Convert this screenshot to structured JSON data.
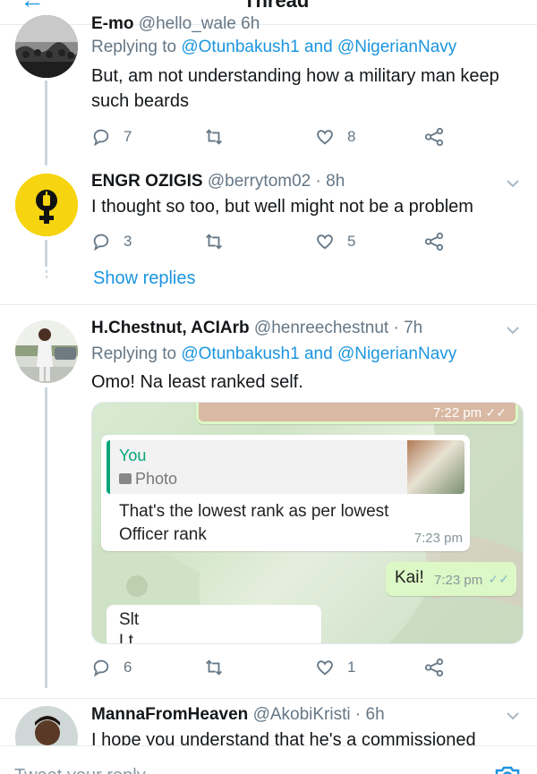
{
  "header": {
    "title": "Thread"
  },
  "tweets": [
    {
      "name": "E-mo",
      "handle": "@hello_wale",
      "time": "6h",
      "replying_prefix": "Replying to ",
      "reply_user1": "@Otunbakush1",
      "reply_and": " and ",
      "reply_user2": "@NigerianNavy",
      "text": "But, am not understanding how a military man keep such beards",
      "replies": "7",
      "retweets": "",
      "likes": "8"
    },
    {
      "name": "ENGR OZIGIS",
      "handle": "@berrytom02",
      "dot": "·",
      "time": "8h",
      "text": "I thought so too, but well might not be a problem",
      "replies": "3",
      "retweets": "",
      "likes": "5"
    },
    {
      "name": "H.Chestnut, ACIArb",
      "handle": "@henreechestnut",
      "dot": "·",
      "time": "7h",
      "replying_prefix": "Replying to ",
      "reply_user1": "@Otunbakush1",
      "reply_and": " and ",
      "reply_user2": "@NigerianNavy",
      "text": "Omo! Na least ranked self.",
      "replies": "6",
      "retweets": "",
      "likes": "1"
    },
    {
      "name": "MannaFromHeaven",
      "handle": "@AkobiKristi",
      "dot": "·",
      "time": "6h",
      "text": "I hope you understand that he's a commissioned"
    }
  ],
  "show_replies": "Show replies",
  "chat": {
    "top_time": "7:22 pm",
    "quote_author": "You",
    "quote_type": "Photo",
    "msg1_line1": "That's the lowest rank as per lowest",
    "msg1_line2": "Officer rank",
    "msg1_time": "7:23 pm",
    "msg2": "Kai!",
    "msg2_time": "7:23 pm",
    "msg3_line1": "Slt",
    "msg3_line2": "Lt"
  },
  "composer": {
    "placeholder": "Tweet your reply"
  },
  "colors": {
    "accent": "#1b95e0",
    "secondary": "#657786",
    "divider": "#e6ecf0",
    "chat_green": "#dcf8c6"
  }
}
